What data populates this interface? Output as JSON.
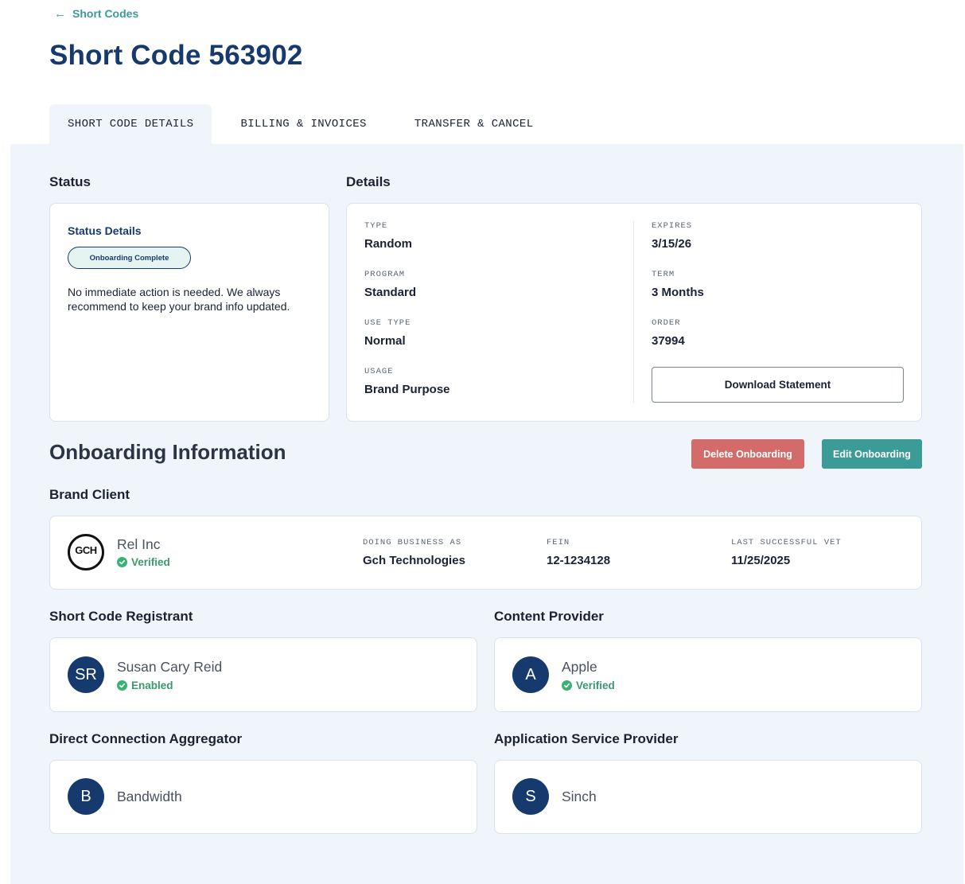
{
  "header": {
    "back_label": "Short Codes",
    "title": "Short Code 563902"
  },
  "tabs": [
    {
      "label": "SHORT CODE DETAILS",
      "active": true
    },
    {
      "label": "BILLING & INVOICES",
      "active": false
    },
    {
      "label": "TRANSFER & CANCEL",
      "active": false
    }
  ],
  "status": {
    "section_label": "Status",
    "card_title": "Status Details",
    "badge": "Onboarding Complete",
    "message": "No immediate action is needed. We always recommend to keep your brand info updated."
  },
  "details": {
    "section_label": "Details",
    "left": [
      {
        "label": "TYPE",
        "value": "Random"
      },
      {
        "label": "PROGRAM",
        "value": "Standard"
      },
      {
        "label": "USE TYPE",
        "value": "Normal"
      },
      {
        "label": "USAGE",
        "value": "Brand Purpose"
      }
    ],
    "right": [
      {
        "label": "EXPIRES",
        "value": "3/15/26"
      },
      {
        "label": "TERM",
        "value": "3 Months"
      },
      {
        "label": "ORDER",
        "value": "37994"
      }
    ],
    "download_label": "Download Statement"
  },
  "onboarding": {
    "title": "Onboarding Information",
    "delete_label": "Delete Onboarding",
    "edit_label": "Edit Onboarding",
    "brand_client": {
      "section_label": "Brand Client",
      "logo_text": "GCH",
      "name": "Rel Inc",
      "status": "Verified",
      "fields": [
        {
          "label": "DOING BUSINESS AS",
          "value": "Gch Technologies"
        },
        {
          "label": "FEIN",
          "value": "12-1234128"
        },
        {
          "label": "LAST SUCCESSFUL VET",
          "value": "11/25/2025"
        }
      ]
    },
    "registrant": {
      "section_label": "Short Code Registrant",
      "initials": "SR",
      "name": "Susan Cary Reid",
      "status": "Enabled"
    },
    "content_provider": {
      "section_label": "Content Provider",
      "initials": "A",
      "name": "Apple",
      "status": "Verified"
    },
    "aggregator": {
      "section_label": "Direct Connection Aggregator",
      "initials": "B",
      "name": "Bandwidth"
    },
    "asp": {
      "section_label": "Application Service Provider",
      "initials": "S",
      "name": "Sinch"
    }
  },
  "colors": {
    "primary_navy": "#173a6e",
    "accent_teal": "#3b9b97",
    "danger": "#d46b6b",
    "success": "#3bb273",
    "panel_bg": "#f0f5fb"
  }
}
